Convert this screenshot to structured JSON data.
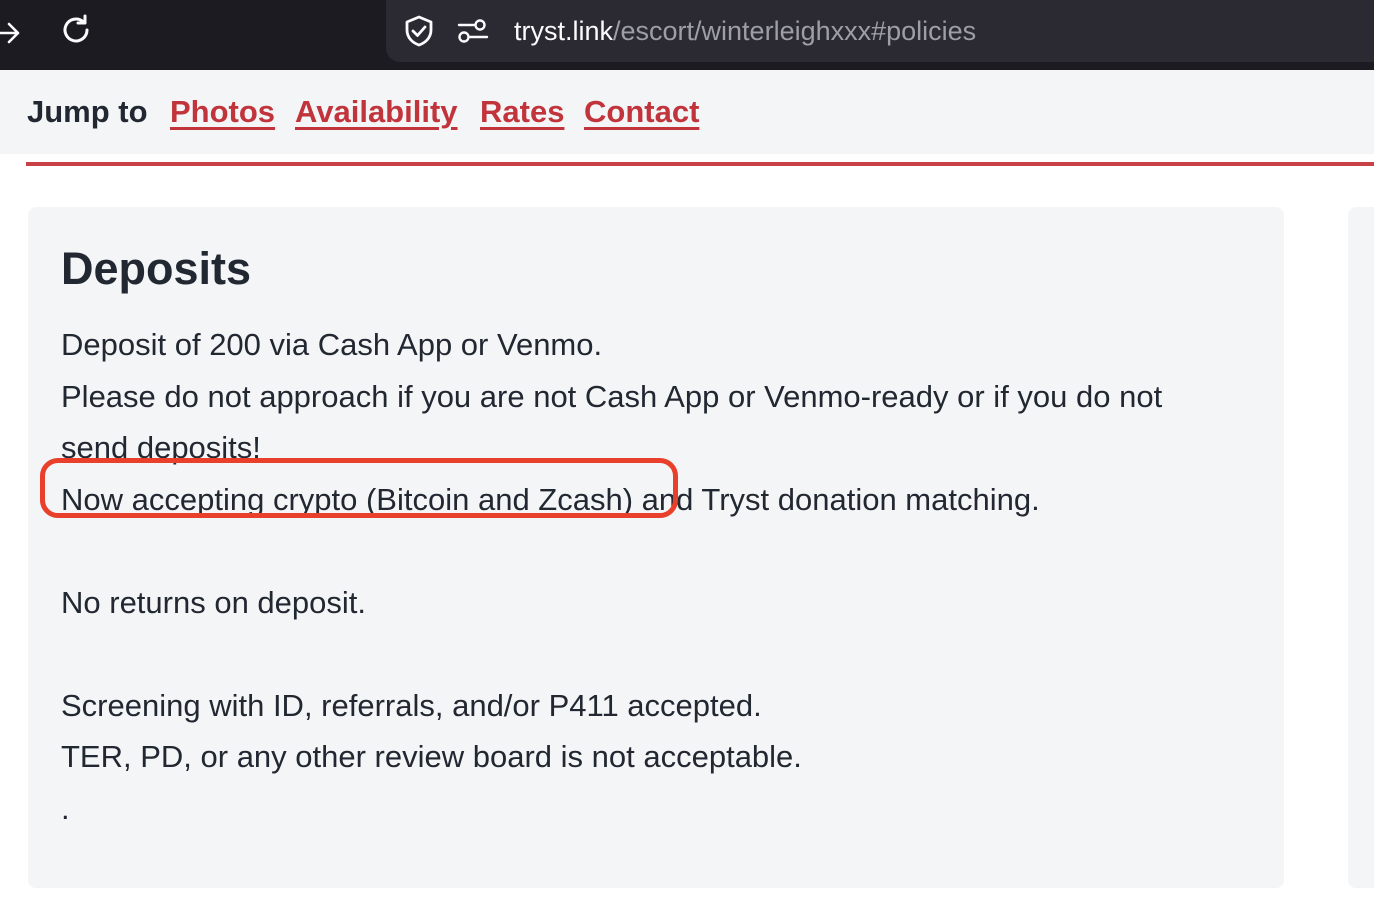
{
  "browser": {
    "url_host": "tryst.link",
    "url_path": "/escort/winterleighxxx#policies"
  },
  "jump_nav": {
    "label": "Jump to",
    "links": [
      "Photos",
      "Availability",
      "Rates",
      "Contact"
    ]
  },
  "deposits": {
    "title": "Deposits",
    "lines": [
      "Deposit of 200 via Cash App or Venmo.",
      "Please do not approach if you are not Cash App or Venmo-ready or if you do not",
      "send deposits!",
      "Now accepting crypto (Bitcoin and Zcash) and Tryst donation matching.",
      "",
      "No returns on deposit.",
      "",
      "Screening with ID, referrals, and/or P411 accepted.",
      "TER, PD, or any other review board is not acceptable.",
      "."
    ]
  },
  "colors": {
    "link": "#c1343b",
    "highlight": "#e8402a",
    "chrome": "#1c1b22"
  }
}
